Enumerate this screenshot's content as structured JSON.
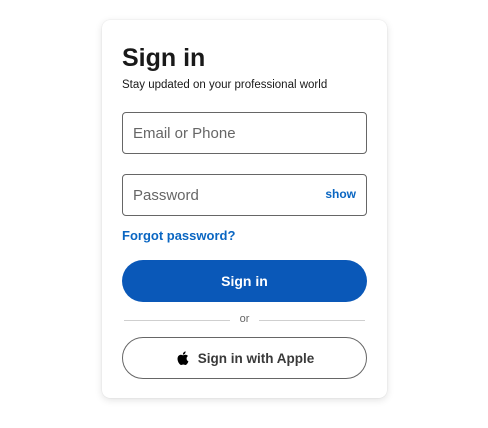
{
  "header": {
    "title": "Sign in",
    "subtitle": "Stay updated on your professional world"
  },
  "form": {
    "email": {
      "value": "",
      "placeholder": "Email or Phone"
    },
    "password": {
      "value": "",
      "placeholder": "Password",
      "toggle_label": "show"
    },
    "forgot_label": "Forgot password?",
    "submit_label": "Sign in",
    "divider_label": "or",
    "apple": {
      "label": "Sign in with Apple",
      "icon": "apple-icon"
    }
  },
  "colors": {
    "primary": "#0a58b8",
    "link": "#0a66c2",
    "text": "#191919",
    "border": "#666666"
  }
}
